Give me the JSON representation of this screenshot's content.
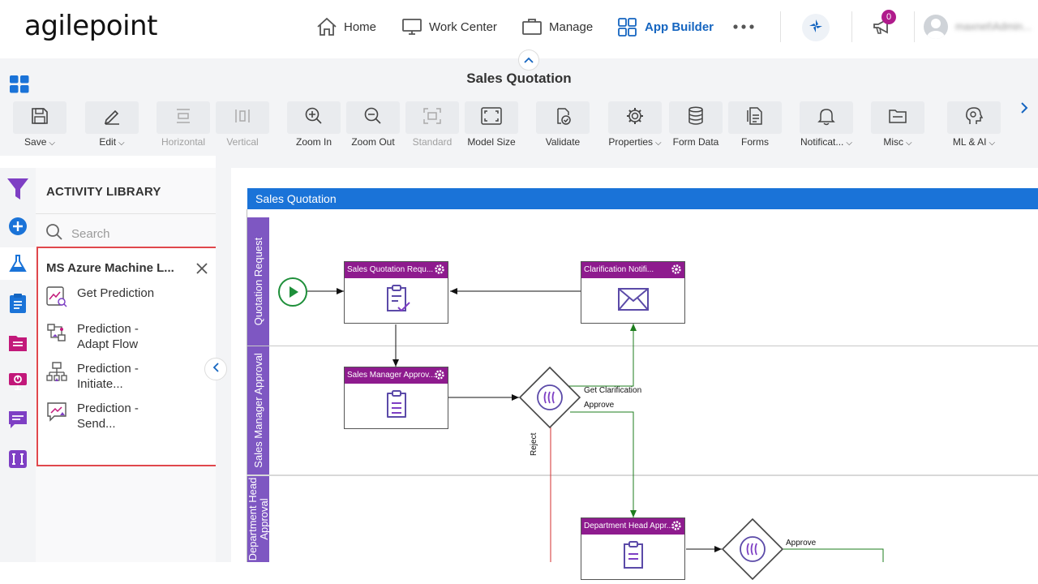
{
  "header": {
    "logo": "agilepoint",
    "nav": [
      {
        "label": "Home"
      },
      {
        "label": "Work Center"
      },
      {
        "label": "Manage"
      },
      {
        "label": "App Builder"
      }
    ],
    "notification_count": "0",
    "user_name": "maxnet\\Admin..."
  },
  "page_title": "Sales Quotation",
  "toolbar": {
    "save": "Save",
    "edit": "Edit",
    "horizontal": "Horizontal",
    "vertical": "Vertical",
    "zoom_in": "Zoom In",
    "zoom_out": "Zoom Out",
    "standard": "Standard",
    "model_size": "Model Size",
    "validate": "Validate",
    "properties": "Properties",
    "form_data": "Form Data",
    "forms": "Forms",
    "notifications": "Notificat...",
    "misc": "Misc",
    "ml_ai": "ML & AI"
  },
  "library": {
    "title": "ACTIVITY LIBRARY",
    "search_placeholder": "Search",
    "panel_title": "MS Azure Machine L...",
    "activities": [
      {
        "label": "Get Prediction",
        "icon": "prediction-chart-icon"
      },
      {
        "label": "Prediction - Adapt Flow",
        "line1": "Prediction -",
        "line2": "Adapt Flow",
        "icon": "adapt-flow-icon"
      },
      {
        "label": "Prediction - Initiate...",
        "line1": "Prediction -",
        "line2": "Initiate...",
        "icon": "initiate-hierarchy-icon"
      },
      {
        "label": "Prediction - Send...",
        "line1": "Prediction -",
        "line2": "Send...",
        "icon": "send-chat-icon"
      }
    ]
  },
  "diagram": {
    "title": "Sales Quotation",
    "lanes": [
      {
        "label": "Quotation Request"
      },
      {
        "label": "Sales Manager Approval"
      },
      {
        "label": "Department Head Approval",
        "line1": "Department Head",
        "line2": "Approval"
      }
    ],
    "tasks": {
      "sales_quotation_request": "Sales Quotation Requ...",
      "clarification_notification": "Clarification Notifi...",
      "sales_manager_approval": "Sales Manager Approv...",
      "department_head_approval": "Department Head Appr..."
    },
    "flow_labels": {
      "get_clarification": "Get Clarification",
      "approve_1": "Approve",
      "reject": "Reject",
      "approve_2": "Approve"
    }
  },
  "colors": {
    "accent": "#1565c0",
    "lane_header": "#7e57c2",
    "task_header": "#8e1b8e",
    "diagram_title_bar": "#1a73d8",
    "highlight_border": "#e0474c"
  }
}
